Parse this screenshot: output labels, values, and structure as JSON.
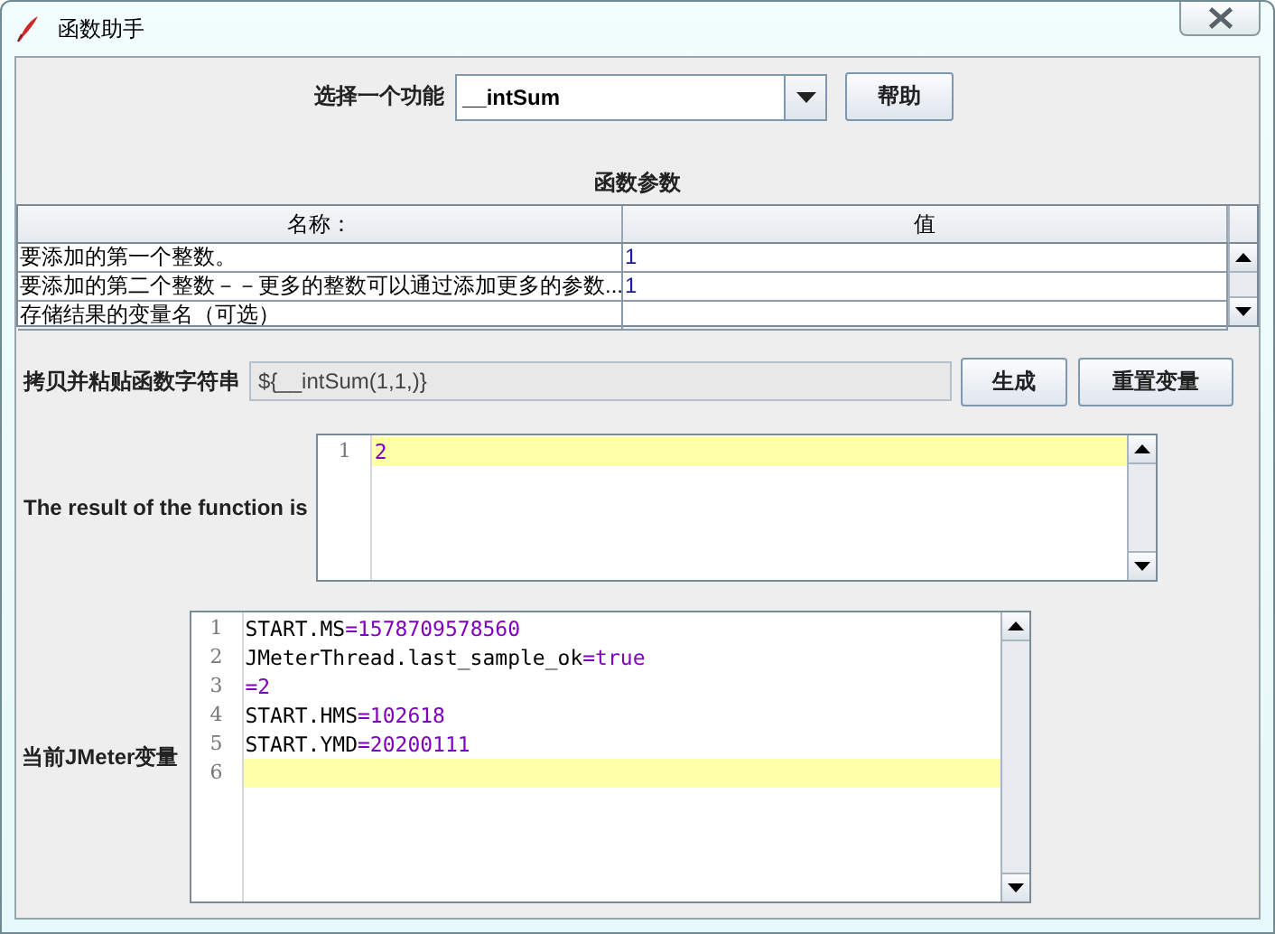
{
  "window": {
    "title": "函数助手"
  },
  "function_select": {
    "label": "选择一个功能",
    "value": "__intSum",
    "help_button": "帮助"
  },
  "parameters": {
    "title": "函数参数",
    "columns": [
      "名称：",
      "值"
    ],
    "rows": [
      {
        "name": "要添加的第一个整数。",
        "value": "1"
      },
      {
        "name": "要添加的第二个整数－－更多的整数可以通过添加更多的参数...",
        "value": "1"
      },
      {
        "name": "存储结果的变量名（可选）"
      }
    ]
  },
  "function_string": {
    "label": "拷贝并粘贴函数字符串",
    "value": "${__intSum(1,1,)}",
    "buttons": [
      "生成",
      "重置变量"
    ]
  },
  "result": {
    "label": "The result of the function is",
    "lines": [
      {
        "number": "1",
        "value": "2",
        "highlighted": true
      }
    ]
  },
  "variables": {
    "label": "当前JMeter变量",
    "lines": [
      {
        "number": "1",
        "key": "START.MS",
        "value": "=1578709578560",
        "highlighted": false
      },
      {
        "number": "2",
        "key": "JMeterThread.last_sample_ok",
        "value": "=true",
        "highlighted": false
      },
      {
        "number": "3",
        "value": "=2",
        "highlighted": false
      },
      {
        "number": "4",
        "key": "START.HMS",
        "value": "=102618",
        "highlighted": false
      },
      {
        "number": "5",
        "key": "START.YMD",
        "value": "=20200111",
        "highlighted": false
      },
      {
        "number": "6",
        "highlighted": true
      }
    ]
  }
}
